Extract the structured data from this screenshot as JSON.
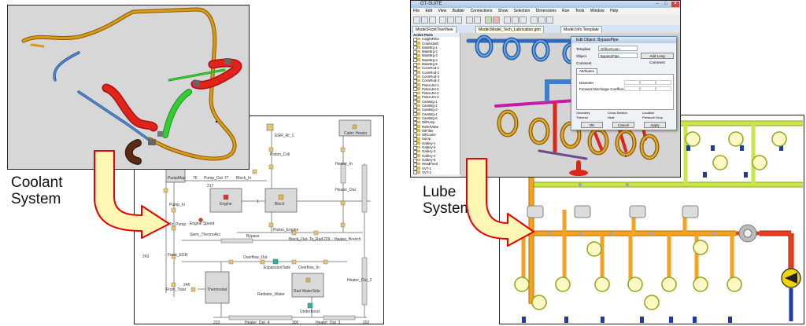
{
  "labels": {
    "coolant_line1": "Coolant",
    "coolant_line2": "System",
    "lube_line1": "Lube",
    "lube_line2": "System"
  },
  "coolant_diagram": {
    "blocks": {
      "egr": "EGR_Rr_1",
      "cabin_heater": "Cabin Heater",
      "pump_map": "PumpMap",
      "engine": "Engine",
      "block": "Block",
      "thermostat": "Thermostat",
      "rad_water_side": "Rad WaterSide"
    },
    "labels": {
      "pump_out": "Pump_Out",
      "block_in": "Block_In",
      "pump_in": "Pump_In",
      "pump_inlet": "Pump_Inlet",
      "engine_speed": "Engine Speed",
      "to_pump": "To_Pump",
      "from_egr": "From_EGR",
      "from_tstat": "From_Tstat",
      "piston_coll": "Piston_Coll",
      "piston_engine": "Piston_Engine",
      "block_out": "Block_Out",
      "to_rad": "To_Rad",
      "heater_branch": "Heater_Branch",
      "heater_in": "Heater_In",
      "heater_out": "Heater_Out",
      "heater_out_2": "Heater_Out_2",
      "heater_out_3": "Heater_Out_3",
      "heater_out_4": "Heater_Out_4",
      "bypass": "Bypass",
      "stem_thermostat": "Stem_ThermoAct",
      "overflow_out": "Overflow_Out",
      "expansion_tank": "ExpansionTank",
      "overflow_in": "Overflow_In",
      "radiator_water": "Radiator_Water",
      "underhood": "Underhood",
      "cab_heater_from": "Cab_Heater_Frm",
      "n223": "223",
      "n233": "233",
      "n271": "271",
      "n246": "246",
      "n243": "243",
      "n202": "202",
      "n201": "201",
      "n76": "76",
      "n77": "77",
      "n83": "83",
      "n85": "85",
      "n11": "11",
      "n12": "12",
      "n229": "229",
      "n217": "217",
      "n227": "227",
      "n300": "300",
      "n1": "1"
    }
  },
  "app_window": {
    "title": "GT-SUITE",
    "menu_items": [
      "File",
      "Edit",
      "View",
      "Builder",
      "Connections",
      "Show",
      "Selection",
      "Dimensions",
      "Run",
      "Tools",
      "Window",
      "Help"
    ],
    "tabs": [
      "Model.FrontTreeView",
      "Model.Model_Tech_Lubrication.gtm",
      "Model Info Template"
    ],
    "tree_header": "Active Parts",
    "tree_items": [
      "InsightFilter",
      "Crankshaft",
      "MainBrg-1",
      "MainBrg-2",
      "MainBrg-3",
      "MainBrg-4",
      "MainBrg-5",
      "ConnRod-1",
      "ConnRod-2",
      "ConnRod-3",
      "ConnRod-4",
      "PistonJet-1",
      "PistonJet-2",
      "PistonJet-3",
      "PistonJet-4",
      "CamBrg-1",
      "CamBrg-2",
      "CamBrg-3",
      "CamBrg-4",
      "CamBrg-5",
      "OilPump",
      "ReliefValve",
      "OilFilter",
      "OilCooler",
      "Sump",
      "Gallery-1",
      "Gallery-2",
      "Gallery-3",
      "Gallery-4",
      "Gallery-5",
      "HeadFeed",
      "VVT-1",
      "VVT-2",
      "Tensioner",
      "Turbo",
      "Chain-1"
    ],
    "dialog": {
      "title": "Edit Object: BypassPipe",
      "template_label": "Template",
      "template_value": "OrificeConn",
      "object_label": "Object",
      "object_value": "BypassPipe",
      "comment_label": "Comment",
      "add_long_comment": "Add Long Comment",
      "section_label": "Attributes",
      "diameter_label": "Diameter",
      "discharge_label": "Forward Discharge Coefficient",
      "cb_labels": [
        "Geometry",
        "Cross Section",
        "Location",
        "Thermal",
        "Heat",
        "Pressure Drop"
      ],
      "ok": "OK",
      "cancel": "Cancel",
      "apply": "Apply"
    }
  },
  "colors": {
    "pipe_gold": "#d99a17",
    "pipe_red": "#e2231a",
    "pipe_green": "#33cc33",
    "pipe_blue": "#4d86c6",
    "lube_orange": "#f4a21f",
    "lube_green": "#c8e64a",
    "lube_red": "#e63d1c",
    "arrow_fill": "#fff7b3",
    "arrow_stroke": "#e60000",
    "node_blue": "#1f3ba8",
    "model_3d_bg": "#d7d7d7"
  }
}
